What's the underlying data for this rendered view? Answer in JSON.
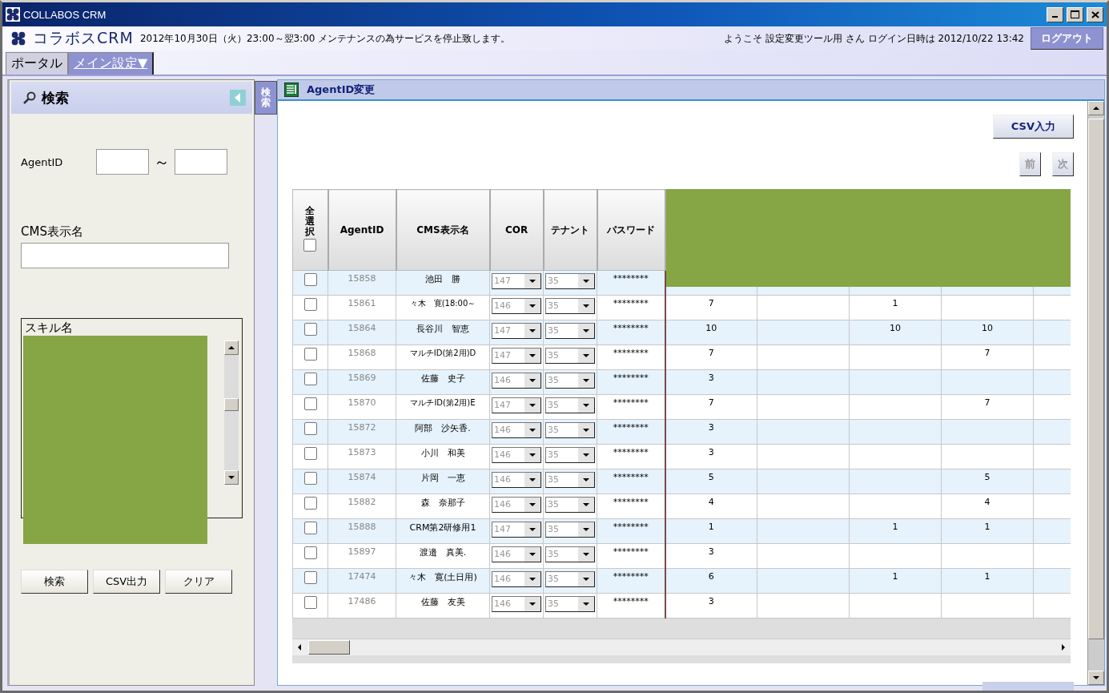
{
  "window": {
    "title": "COLLABOS CRM"
  },
  "header": {
    "logo": "コラボスCRM",
    "notice": "2012年10月30日（火）23:00～翌3:00 メンテナンスの為サービスを停止致します。",
    "welcome": "ようこそ 設定変更ツール用 さん ログイン日時は 2012/10/22 13:42",
    "logout": "ログアウト"
  },
  "tabs": [
    {
      "label": "ポータル",
      "selected": false
    },
    {
      "label": "メイン設定▼",
      "selected": true
    }
  ],
  "search_panel": {
    "title": "検索",
    "side_tab": "検索",
    "agent_id_label": "AgentID",
    "range_separator": "～",
    "cms_label": "CMS表示名",
    "skill_label": "スキル名",
    "buttons": [
      "検索",
      "CSV出力",
      "クリア"
    ]
  },
  "content": {
    "title": "AgentID変更",
    "csv_button": "CSV入力",
    "prev_button": "前",
    "next_button": "次",
    "table": {
      "columns": [
        "全選択",
        "AgentID",
        "CMS表示名",
        "COR",
        "テナント",
        "パスワード"
      ],
      "select_all": {
        "checked": false
      },
      "rows": [
        {
          "checked": false,
          "agent_id": "15858",
          "name": "池田　勝",
          "cor": "147",
          "tenant": "35",
          "password": "********"
        },
        {
          "checked": false,
          "agent_id": "15861",
          "name": "々木　寛(18:00～",
          "cor": "146",
          "tenant": "35",
          "password": "********",
          "skills": {
            "column_7": "7",
            "column_9": "1"
          }
        },
        {
          "checked": false,
          "agent_id": "15864",
          "name": "長谷川　智恵",
          "cor": "147",
          "tenant": "35",
          "password": "********",
          "skills": {
            "column_7": "10",
            "column_9": "10",
            "column_10": "10"
          }
        },
        {
          "checked": false,
          "agent_id": "15868",
          "name": "マルチID(第2用)D",
          "cor": "147",
          "tenant": "35",
          "password": "********",
          "skills": {
            "column_7": "7",
            "column_10": "7"
          }
        },
        {
          "checked": false,
          "agent_id": "15869",
          "name": "佐藤　史子",
          "cor": "146",
          "tenant": "35",
          "password": "********",
          "skills": {
            "column_7": "3"
          }
        },
        {
          "checked": false,
          "agent_id": "15870",
          "name": "マルチID(第2用)E",
          "cor": "147",
          "tenant": "35",
          "password": "********",
          "skills": {
            "column_7": "7",
            "column_10": "7"
          }
        },
        {
          "checked": false,
          "agent_id": "15872",
          "name": "阿部　沙矢香.",
          "cor": "146",
          "tenant": "35",
          "password": "********",
          "skills": {
            "column_7": "3"
          }
        },
        {
          "checked": false,
          "agent_id": "15873",
          "name": "小川　和美",
          "cor": "146",
          "tenant": "35",
          "password": "********",
          "skills": {
            "column_7": "3"
          }
        },
        {
          "checked": false,
          "agent_id": "15874",
          "name": "片岡　一恵",
          "cor": "146",
          "tenant": "35",
          "password": "********",
          "skills": {
            "column_7": "5",
            "column_10": "5"
          }
        },
        {
          "checked": false,
          "agent_id": "15882",
          "name": "森　奈那子",
          "cor": "146",
          "tenant": "35",
          "password": "********",
          "skills": {
            "column_7": "4",
            "column_10": "4"
          }
        },
        {
          "checked": false,
          "agent_id": "15888",
          "name": "CRM第2研修用1",
          "cor": "147",
          "tenant": "35",
          "password": "********",
          "skills": {
            "column_7": "1",
            "column_9": "1",
            "column_10": "1"
          }
        },
        {
          "checked": false,
          "agent_id": "15897",
          "name": "渡邉　真美.",
          "cor": "146",
          "tenant": "35",
          "password": "********",
          "skills": {
            "column_7": "3"
          }
        },
        {
          "checked": false,
          "agent_id": "17474",
          "name": "々木　寛(土日用)",
          "cor": "146",
          "tenant": "35",
          "password": "********",
          "skills": {
            "column_7": "6",
            "column_9": "1",
            "column_10": "1"
          }
        },
        {
          "checked": false,
          "agent_id": "17486",
          "name": "佐藤　友美",
          "cor": "146",
          "tenant": "35",
          "password": "********",
          "skills": {
            "column_7": "3"
          }
        }
      ]
    }
  }
}
